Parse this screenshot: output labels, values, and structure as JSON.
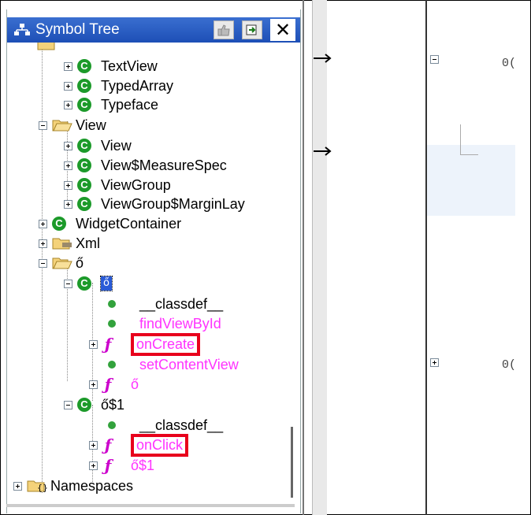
{
  "panel": {
    "title": "Symbol Tree",
    "close_label": "✕"
  },
  "tree": [
    {
      "label": "TextView",
      "icon": "class-icon"
    },
    {
      "label": "TypedArray",
      "icon": "class-icon"
    },
    {
      "label": "Typeface",
      "icon": "class-icon"
    },
    {
      "label": "View",
      "icon": "folder-icon"
    },
    {
      "label": "View",
      "icon": "class-icon"
    },
    {
      "label": "View$MeasureSpec",
      "icon": "class-icon"
    },
    {
      "label": "ViewGroup",
      "icon": "class-icon"
    },
    {
      "label": "ViewGroup$MarginLay",
      "icon": "class-icon"
    },
    {
      "label": "WidgetContainer",
      "icon": "class-icon"
    },
    {
      "label": "Xml",
      "icon": "folder-icon"
    },
    {
      "label": "ő",
      "icon": "folder-icon"
    },
    {
      "label": "ő",
      "icon": "class-icon"
    },
    {
      "label": "__classdef__",
      "icon": "field-icon"
    },
    {
      "label": "findViewById",
      "icon": "field-icon"
    },
    {
      "label": "onCreate",
      "icon": "function-icon"
    },
    {
      "label": "setContentView",
      "icon": "field-icon"
    },
    {
      "label": "ő",
      "icon": "function-icon"
    },
    {
      "label": "ő$1",
      "icon": "class-icon"
    },
    {
      "label": "__classdef__",
      "icon": "field-icon"
    },
    {
      "label": "onClick",
      "icon": "function-icon"
    },
    {
      "label": "ő$1",
      "icon": "function-icon"
    },
    {
      "label": "Namespaces",
      "icon": "namespace-folder-icon"
    }
  ],
  "right": {
    "text_1": "0(",
    "text_2": "0("
  },
  "colors": {
    "titlebar": "#1d4fb6",
    "highlight_box": "#e8001c",
    "magenta_text": "#ff33ff",
    "class_icon": "#1c9a2a"
  }
}
